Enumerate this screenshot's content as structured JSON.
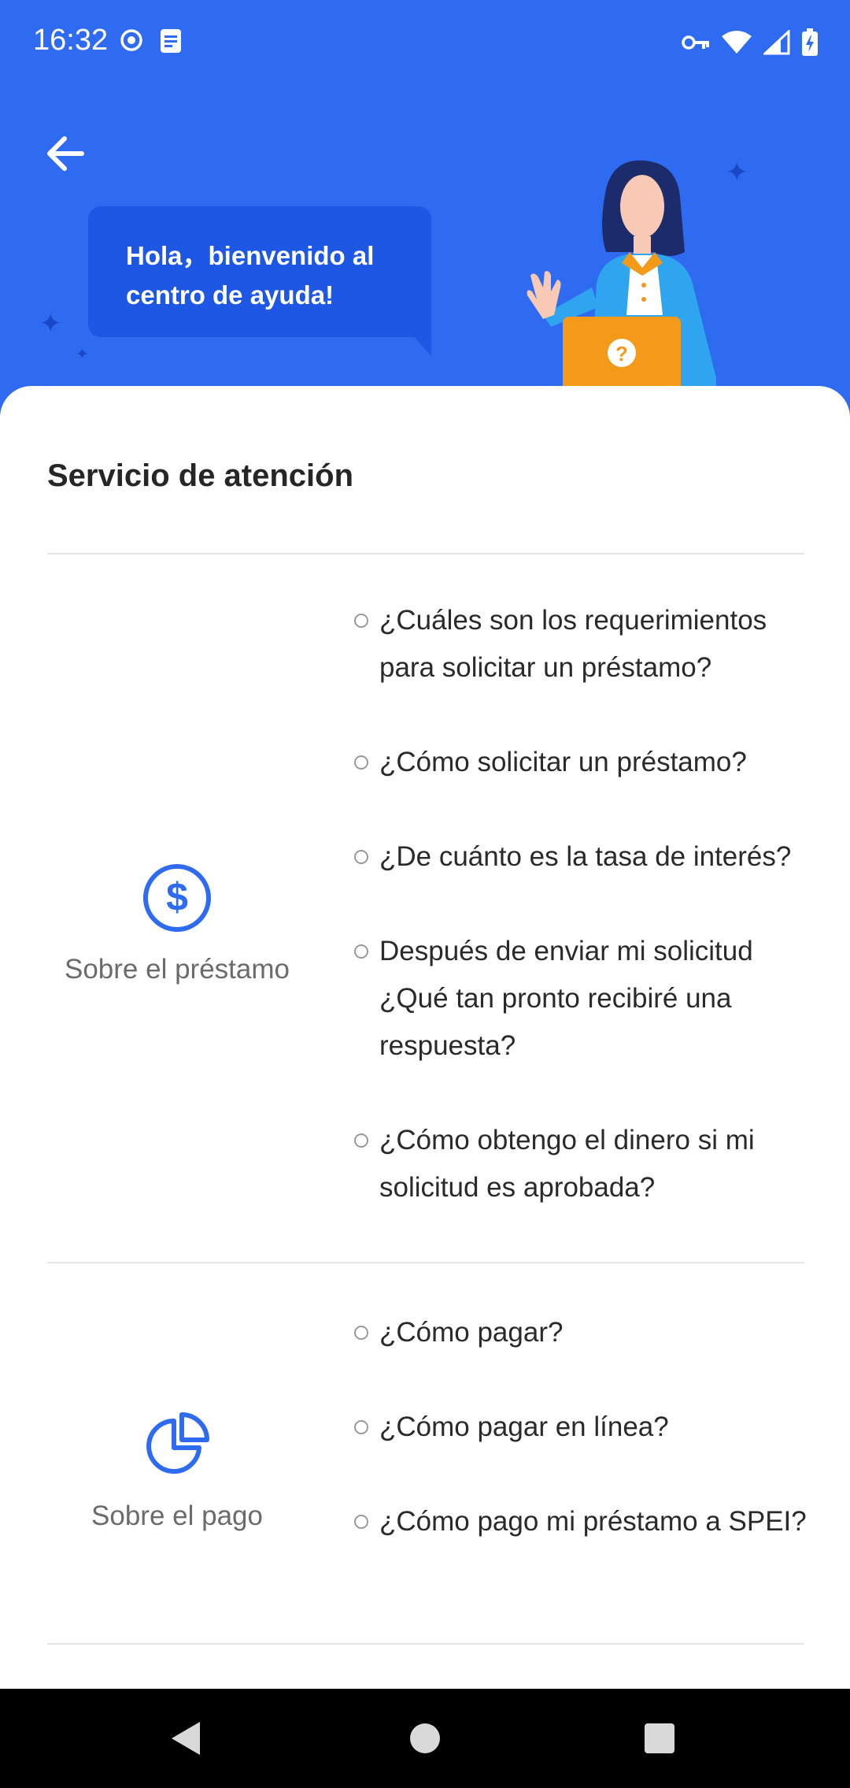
{
  "status_bar": {
    "time": "16:32",
    "icons": [
      "record-icon",
      "notes-icon",
      "vpn-key-icon",
      "wifi-icon",
      "signal-icon",
      "battery-charging-icon"
    ]
  },
  "header": {
    "back_icon": "arrow-left-icon",
    "greeting_line1": "Hola，bienvenido al",
    "greeting_line2": "centro de ayuda!",
    "colors": {
      "background": "#2f6bf0",
      "bubble": "#1e57e3"
    }
  },
  "main": {
    "title": "Servicio de atención",
    "sections": [
      {
        "category_label": "Sobre el préstamo",
        "icon": "dollar-circle-icon",
        "questions": [
          "¿Cuáles son los requerimientos para solicitar un préstamo?",
          "¿Cómo solicitar un préstamo?",
          "¿De cuánto es la tasa de interés?",
          "Después de enviar mi solicitud ¿Qué tan pronto recibiré una respuesta?",
          "¿Cómo obtengo el dinero si mi solicitud es aprobada?"
        ]
      },
      {
        "category_label": "Sobre el pago",
        "icon": "pie-chart-icon",
        "questions": [
          "¿Cómo pagar?",
          "¿Cómo pagar en línea?",
          "¿Cómo pago mi préstamo a SPEI?"
        ]
      }
    ]
  },
  "nav_bar": {
    "buttons": [
      "back-triangle-icon",
      "home-circle-icon",
      "recents-square-icon"
    ]
  }
}
